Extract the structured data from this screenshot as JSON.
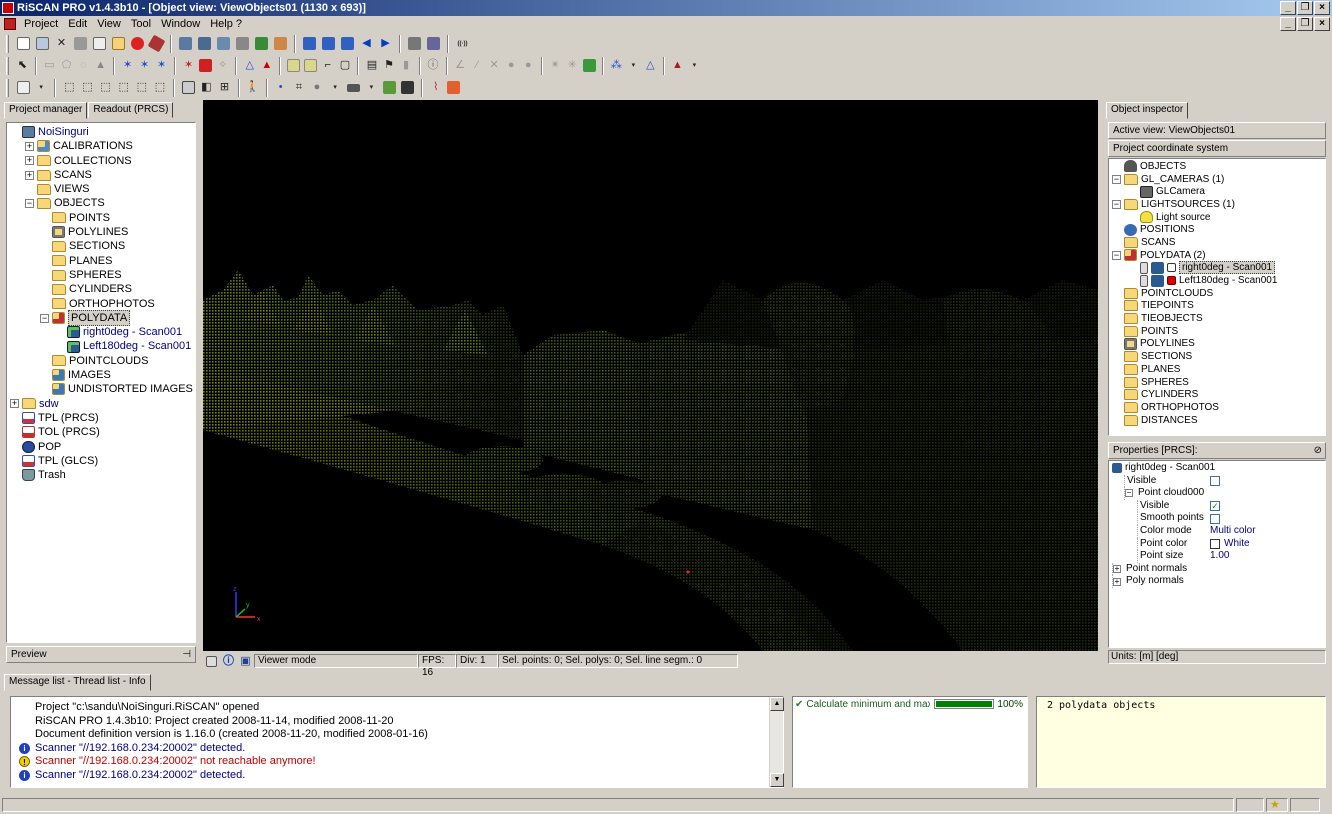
{
  "window": {
    "title": "RiSCAN PRO v1.4.3b10 - [Object view: ViewObjects01 (1130 x 693)]"
  },
  "menu": [
    "Project",
    "Edit",
    "View",
    "Tool",
    "Window",
    "Help ?"
  ],
  "left_panel": {
    "tabs": [
      "Project manager",
      "Readout (PRCS)"
    ],
    "tree": [
      {
        "label": "NoiSinguri",
        "level": 0,
        "exp": "",
        "icon": "project",
        "blue": true
      },
      {
        "label": "CALIBRATIONS",
        "level": 1,
        "exp": "+",
        "icon": "calib"
      },
      {
        "label": "COLLECTIONS",
        "level": 1,
        "exp": "+",
        "icon": "folder"
      },
      {
        "label": "SCANS",
        "level": 1,
        "exp": "+",
        "icon": "folder"
      },
      {
        "label": "VIEWS",
        "level": 1,
        "exp": "",
        "icon": "folder"
      },
      {
        "label": "OBJECTS",
        "level": 1,
        "exp": "-",
        "icon": "folder"
      },
      {
        "label": "POINTS",
        "level": 2,
        "exp": "",
        "icon": "folder"
      },
      {
        "label": "POLYLINES",
        "level": 2,
        "exp": "",
        "icon": "polyline"
      },
      {
        "label": "SECTIONS",
        "level": 2,
        "exp": "",
        "icon": "folder"
      },
      {
        "label": "PLANES",
        "level": 2,
        "exp": "",
        "icon": "folder"
      },
      {
        "label": "SPHERES",
        "level": 2,
        "exp": "",
        "icon": "folder"
      },
      {
        "label": "CYLINDERS",
        "level": 2,
        "exp": "",
        "icon": "folder"
      },
      {
        "label": "ORTHOPHOTOS",
        "level": 2,
        "exp": "",
        "icon": "folder"
      },
      {
        "label": "POLYDATA",
        "level": 2,
        "exp": "-",
        "icon": "polydata",
        "sel": true
      },
      {
        "label": "right0deg - Scan001",
        "level": 3,
        "exp": "",
        "icon": "scan",
        "blue": true
      },
      {
        "label": "Left180deg - Scan001",
        "level": 3,
        "exp": "",
        "icon": "scan",
        "blue": true
      },
      {
        "label": "POINTCLOUDS",
        "level": 2,
        "exp": "",
        "icon": "folder"
      },
      {
        "label": "IMAGES",
        "level": 2,
        "exp": "",
        "icon": "image"
      },
      {
        "label": "UNDISTORTED IMAGES",
        "level": 2,
        "exp": "",
        "icon": "image"
      },
      {
        "label": "sdw",
        "level": 0,
        "exp": "+",
        "icon": "folder",
        "blue": true
      },
      {
        "label": "TPL (PRCS)",
        "level": 0,
        "exp": "",
        "icon": "tpl"
      },
      {
        "label": "TOL (PRCS)",
        "level": 0,
        "exp": "",
        "icon": "tol"
      },
      {
        "label": "POP",
        "level": 0,
        "exp": "",
        "icon": "pop"
      },
      {
        "label": "TPL (GLCS)",
        "level": 0,
        "exp": "",
        "icon": "tpl"
      },
      {
        "label": "Trash",
        "level": 0,
        "exp": "",
        "icon": "trash"
      }
    ],
    "preview_label": "Preview"
  },
  "view_status": {
    "mode": "Viewer mode",
    "fps": "FPS: 16",
    "div": "Div: 1",
    "selection": "Sel. points: 0;  Sel. polys: 0;  Sel. line segm.: 0"
  },
  "object_inspector": {
    "tab": "Object inspector",
    "active_view": "Active view:  ViewObjects01",
    "coord_system": "Project coordinate system",
    "tree": [
      {
        "label": "OBJECTS",
        "level": 0,
        "exp": "",
        "icon": "objects"
      },
      {
        "label": "GL_CAMERAS (1)",
        "level": 0,
        "exp": "-",
        "icon": "folder"
      },
      {
        "label": "GLCamera",
        "level": 1,
        "exp": "",
        "icon": "camera"
      },
      {
        "label": "LIGHTSOURCES (1)",
        "level": 0,
        "exp": "-",
        "icon": "folder"
      },
      {
        "label": "Light source",
        "level": 1,
        "exp": "",
        "icon": "light"
      },
      {
        "label": "POSITIONS",
        "level": 0,
        "exp": "",
        "icon": "positions"
      },
      {
        "label": "SCANS",
        "level": 0,
        "exp": "",
        "icon": "folder"
      },
      {
        "label": "POLYDATA (2)",
        "level": 0,
        "exp": "-",
        "icon": "polydata"
      },
      {
        "label": "right0deg - Scan001",
        "level": 1,
        "exp": "",
        "icon": "scan-white",
        "sel": true
      },
      {
        "label": "Left180deg - Scan001",
        "level": 1,
        "exp": "",
        "icon": "scan-red"
      },
      {
        "label": "POINTCLOUDS",
        "level": 0,
        "exp": "",
        "icon": "folder"
      },
      {
        "label": "TIEPOINTS",
        "level": 0,
        "exp": "",
        "icon": "folder"
      },
      {
        "label": "TIEOBJECTS",
        "level": 0,
        "exp": "",
        "icon": "folder"
      },
      {
        "label": "POINTS",
        "level": 0,
        "exp": "",
        "icon": "folder"
      },
      {
        "label": "POLYLINES",
        "level": 0,
        "exp": "",
        "icon": "polyline"
      },
      {
        "label": "SECTIONS",
        "level": 0,
        "exp": "",
        "icon": "folder"
      },
      {
        "label": "PLANES",
        "level": 0,
        "exp": "",
        "icon": "folder"
      },
      {
        "label": "SPHERES",
        "level": 0,
        "exp": "",
        "icon": "folder"
      },
      {
        "label": "CYLINDERS",
        "level": 0,
        "exp": "",
        "icon": "folder"
      },
      {
        "label": "ORTHOPHOTOS",
        "level": 0,
        "exp": "",
        "icon": "folder"
      },
      {
        "label": "DISTANCES",
        "level": 0,
        "exp": "",
        "icon": "folder"
      }
    ]
  },
  "properties": {
    "header": "Properties [PRCS]:",
    "object_name": "right0deg - Scan001",
    "rows": [
      {
        "key": "Visible",
        "indent": 1,
        "val": "",
        "cb": "unchecked"
      },
      {
        "key": "Point cloud000",
        "indent": 1,
        "val": "",
        "exp": "-"
      },
      {
        "key": "Visible",
        "indent": 2,
        "val": "",
        "cb": "checked"
      },
      {
        "key": "Smooth points",
        "indent": 2,
        "val": "",
        "cb": "unchecked"
      },
      {
        "key": "Color mode",
        "indent": 2,
        "val": "Multi color"
      },
      {
        "key": "Point color",
        "indent": 2,
        "val": "White",
        "swatch": "#ffffff"
      },
      {
        "key": "Point size",
        "indent": 2,
        "val": "1.00"
      },
      {
        "key": "Point normals",
        "indent": 0,
        "val": "",
        "exp": "+"
      },
      {
        "key": "Poly normals",
        "indent": 0,
        "val": "",
        "exp": "+"
      }
    ],
    "units": "Units: [m] [deg]"
  },
  "bottom": {
    "tab": "Message list - Thread list - Info",
    "messages": [
      {
        "type": "none",
        "text": "Project \"c:\\sandu\\NoiSinguri.RiSCAN\" opened"
      },
      {
        "type": "none",
        "text": "RiSCAN PRO 1.4.3b10: Project created 2008-11-14, modified 2008-11-20"
      },
      {
        "type": "none",
        "text": "Document definition version is 1.16.0 (created 2008-11-20, modified 2008-01-16)"
      },
      {
        "type": "info",
        "text": "Scanner \"//192.168.0.234:20002\" detected."
      },
      {
        "type": "warn",
        "text": "Scanner \"//192.168.0.234:20002\" not reachable anymore!"
      },
      {
        "type": "info",
        "text": "Scanner \"//192.168.0.234:20002\" detected."
      }
    ],
    "thread": {
      "label": "Calculate minimum and maxim...",
      "progress": 1.0,
      "percent": "100%"
    },
    "info_text": "2 polydata objects"
  },
  "colors": {
    "accent": "#0a246a",
    "info_bg": "#ffffe1",
    "progress": "#008000"
  }
}
